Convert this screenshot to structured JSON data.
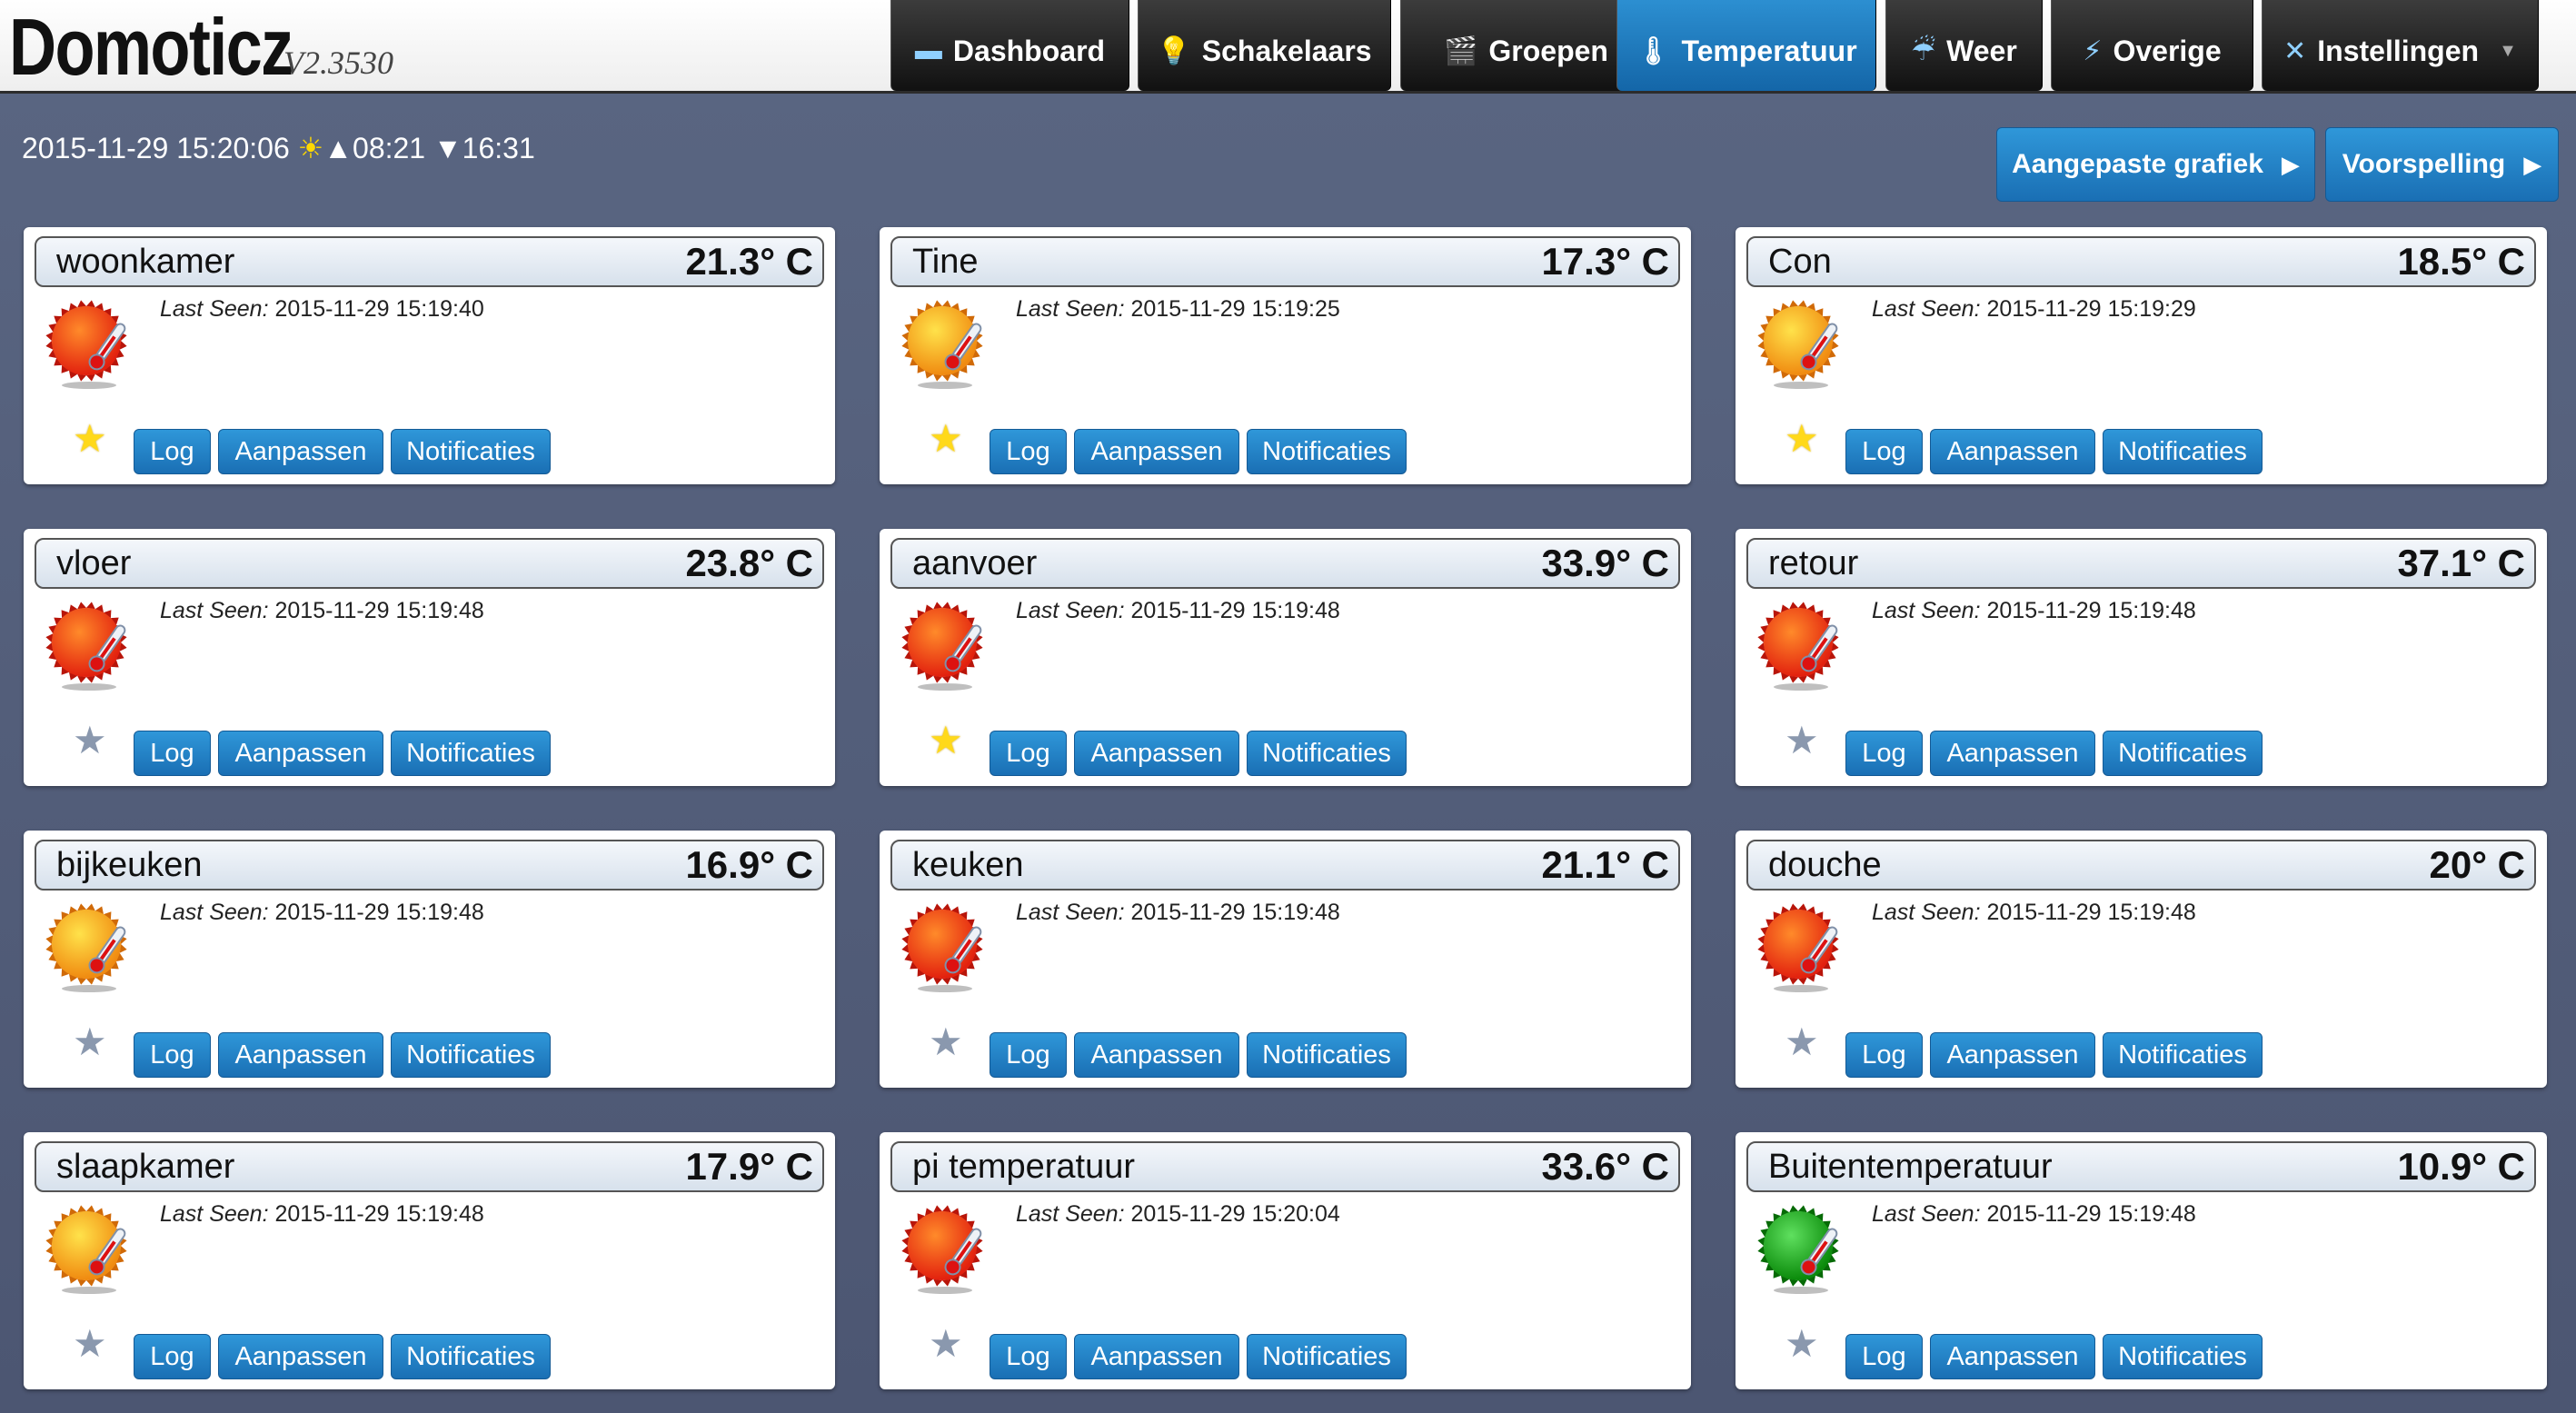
{
  "app": {
    "title": "Domoticz",
    "version": "V2.3530"
  },
  "nav": [
    {
      "label": "Dashboard",
      "icon": "monitor-icon",
      "glyph": "▬",
      "active": false
    },
    {
      "label": "Schakelaars",
      "icon": "lightbulb-icon",
      "glyph": "💡",
      "active": false
    },
    {
      "label": "Groepen",
      "icon": "scene-icon",
      "glyph": "🎬",
      "active": false
    },
    {
      "label": "Temperatuur",
      "icon": "thermometer-icon",
      "glyph": "🌡",
      "active": true
    },
    {
      "label": "Weer",
      "icon": "weather-icon",
      "glyph": "☔",
      "active": false
    },
    {
      "label": "Overige",
      "icon": "utility-icon",
      "glyph": "⚡",
      "active": false
    },
    {
      "label": "Instellingen",
      "icon": "tools-icon",
      "glyph": "✕",
      "active": false,
      "has_dropdown": true
    }
  ],
  "info": {
    "datetime": "2015-11-29 15:20:06",
    "sunrise": "08:21",
    "sunset": "16:31"
  },
  "toolbar": {
    "custom_graph": "Aangepaste grafiek",
    "forecast": "Voorspelling"
  },
  "buttons": {
    "log": "Log",
    "edit": "Aanpassen",
    "notifications": "Notificaties"
  },
  "last_seen_label": "Last Seen:",
  "colors": {
    "accent": "#1f7dc1",
    "nav_dark": "#1a1a1a",
    "background": "#4f5a76",
    "sensor_hot": "#e8321a",
    "sensor_warm": "#f29a12",
    "sensor_cold": "#1aa61a"
  },
  "sensors": [
    {
      "name": "woonkamer",
      "temp": "21.3° C",
      "last_seen": "2015-11-29 15:19:40",
      "level": "hot",
      "favorite": true
    },
    {
      "name": "Tine",
      "temp": "17.3° C",
      "last_seen": "2015-11-29 15:19:25",
      "level": "warm",
      "favorite": true
    },
    {
      "name": "Con",
      "temp": "18.5° C",
      "last_seen": "2015-11-29 15:19:29",
      "level": "warm",
      "favorite": true
    },
    {
      "name": "vloer",
      "temp": "23.8° C",
      "last_seen": "2015-11-29 15:19:48",
      "level": "hot",
      "favorite": false
    },
    {
      "name": "aanvoer",
      "temp": "33.9° C",
      "last_seen": "2015-11-29 15:19:48",
      "level": "hot",
      "favorite": true
    },
    {
      "name": "retour",
      "temp": "37.1° C",
      "last_seen": "2015-11-29 15:19:48",
      "level": "hot",
      "favorite": false
    },
    {
      "name": "bijkeuken",
      "temp": "16.9° C",
      "last_seen": "2015-11-29 15:19:48",
      "level": "warm",
      "favorite": false
    },
    {
      "name": "keuken",
      "temp": "21.1° C",
      "last_seen": "2015-11-29 15:19:48",
      "level": "hot",
      "favorite": false
    },
    {
      "name": "douche",
      "temp": "20° C",
      "last_seen": "2015-11-29 15:19:48",
      "level": "hot",
      "favorite": false
    },
    {
      "name": "slaapkamer",
      "temp": "17.9° C",
      "last_seen": "2015-11-29 15:19:48",
      "level": "warm",
      "favorite": false
    },
    {
      "name": "pi temperatuur",
      "temp": "33.6° C",
      "last_seen": "2015-11-29 15:20:04",
      "level": "hot",
      "favorite": false
    },
    {
      "name": "Buitentemperatuur",
      "temp": "10.9° C",
      "last_seen": "2015-11-29 15:19:48",
      "level": "cold",
      "favorite": false
    }
  ]
}
